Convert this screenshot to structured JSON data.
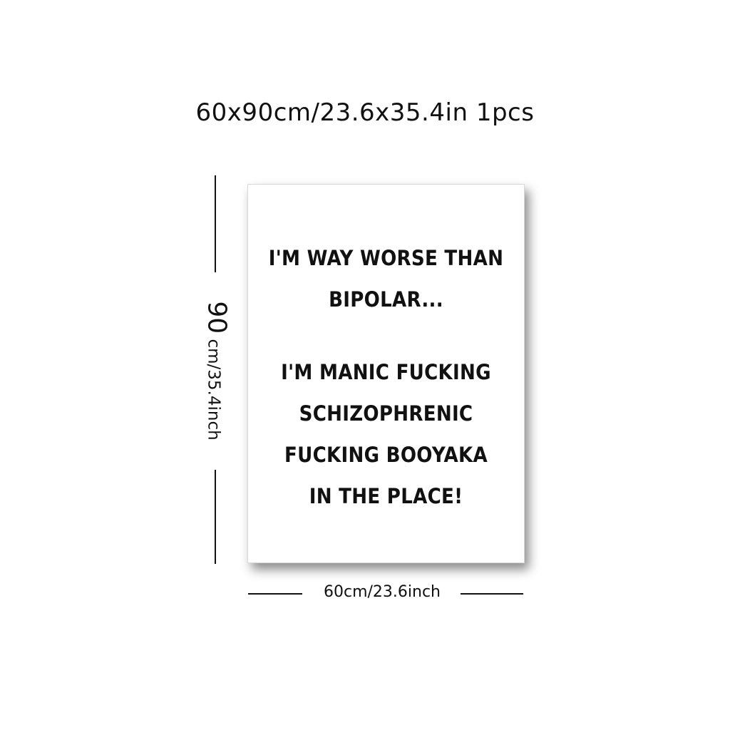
{
  "header": {
    "size_text": "60x90cm/23.6x35.4in",
    "quantity_text": "1pcs"
  },
  "poster": {
    "lines_block1": [
      "I'M WAY WORSE THAN",
      "BIPOLAR..."
    ],
    "lines_block2": [
      "I'M MANIC FUCKING",
      "SCHIZOPHRENIC",
      "FUCKING BOOYAKA",
      "IN THE PLACE!"
    ]
  },
  "dimensions": {
    "height_number": "90",
    "height_rest": "cm/35.4inch",
    "width_label": "60cm/23.6inch"
  }
}
